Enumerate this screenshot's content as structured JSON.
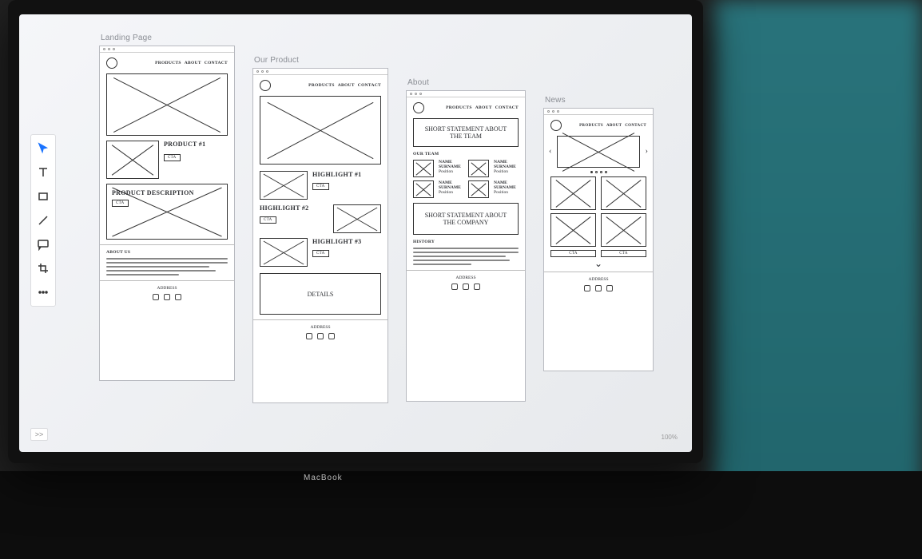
{
  "tool": {
    "zoom_text": "100%",
    "pan_label": ">>",
    "tools": [
      "select",
      "text",
      "rectangle",
      "line",
      "comment",
      "crop",
      "more"
    ]
  },
  "nav_items": [
    "PRODUCTS",
    "ABOUT",
    "CONTACT"
  ],
  "artboards": {
    "landing": {
      "label": "Landing Page",
      "product1_title": "PRODUCT #1",
      "cta": "CTA",
      "product_desc_title": "PRODUCT DESCRIPTION",
      "about_us_title": "ABOUT US",
      "footer_label": "ADDRESS"
    },
    "product": {
      "label": "Our Product",
      "highlight1": "HIGHLIGHT #1",
      "highlight2": "HIGHLIGHT #2",
      "highlight3": "HIGHLIGHT #3",
      "cta": "CTA",
      "details": "DETAILS",
      "footer_label": "ADDRESS"
    },
    "about": {
      "label": "About",
      "statement_team": "SHORT STATEMENT ABOUT THE TEAM",
      "our_team": "OUR TEAM",
      "member_name": "NAME SURNAME",
      "member_role": "Position",
      "statement_company": "SHORT STATEMENT ABOUT THE COMPANY",
      "history": "HISTORY",
      "footer_label": "ADDRESS"
    },
    "news": {
      "label": "News",
      "cta": "CTA",
      "footer_label": "ADDRESS"
    }
  },
  "laptop_brand": "MacBook"
}
